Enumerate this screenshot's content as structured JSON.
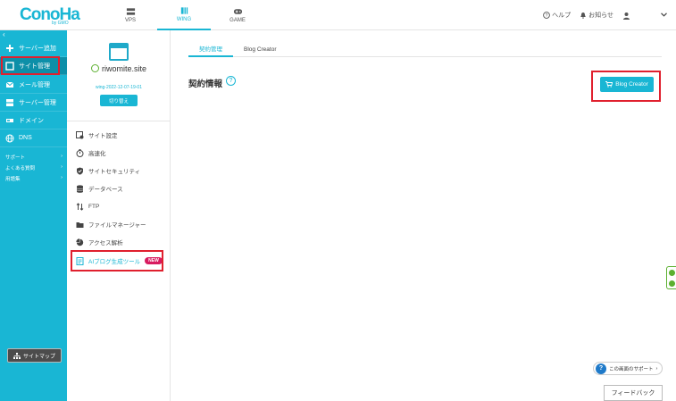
{
  "header": {
    "logo": "ConoHa",
    "logo_sub": "by GMO",
    "tabs": [
      {
        "label": "VPS",
        "icon": "server-icon"
      },
      {
        "label": "WING",
        "icon": "wing-icon"
      },
      {
        "label": "GAME",
        "icon": "gamepad-icon"
      }
    ],
    "help_label": "ヘルプ",
    "notice_label": "お知らせ"
  },
  "sidebar": {
    "items": [
      {
        "label": "サーバー追加",
        "icon": "plus-icon"
      },
      {
        "label": "サイト管理",
        "icon": "window-icon"
      },
      {
        "label": "メール管理",
        "icon": "mail-icon"
      },
      {
        "label": "サーバー管理",
        "icon": "server-icon"
      },
      {
        "label": "ドメイン",
        "icon": "domain-icon"
      },
      {
        "label": "DNS",
        "icon": "globe-icon"
      }
    ],
    "links": [
      {
        "label": "サポート"
      },
      {
        "label": "よくある質問"
      },
      {
        "label": "用語集"
      }
    ],
    "sitemap_label": "サイトマップ"
  },
  "panel": {
    "site_name": "riwomite.site",
    "site_id": "wing-2022-12-07-19-01",
    "switch_label": "切り替え",
    "menu": [
      {
        "label": "サイト設定",
        "icon": "site-settings-icon"
      },
      {
        "label": "高速化",
        "icon": "stopwatch-icon"
      },
      {
        "label": "サイトセキュリティ",
        "icon": "shield-icon"
      },
      {
        "label": "データベース",
        "icon": "database-icon"
      },
      {
        "label": "FTP",
        "icon": "transfer-icon"
      },
      {
        "label": "ファイルマネージャー",
        "icon": "folder-icon"
      },
      {
        "label": "アクセス解析",
        "icon": "pie-chart-icon"
      },
      {
        "label": "AIブログ生成ツール",
        "icon": "document-icon",
        "badge": "NEW"
      }
    ]
  },
  "main": {
    "tabs": [
      {
        "label": "契約管理"
      },
      {
        "label": "Blog Creator"
      }
    ],
    "title": "契約情報",
    "help_glyph": "?",
    "blog_creator_button": "Blog Creator",
    "support_label": "この画面のサポート",
    "feedback_label": "フィードバック"
  },
  "colors": {
    "accent": "#19b6d4",
    "sidebar_active": "#0d8fa8",
    "highlight_box": "#e0202e",
    "new_badge": "#d81b60",
    "power_green": "#5cb030"
  }
}
